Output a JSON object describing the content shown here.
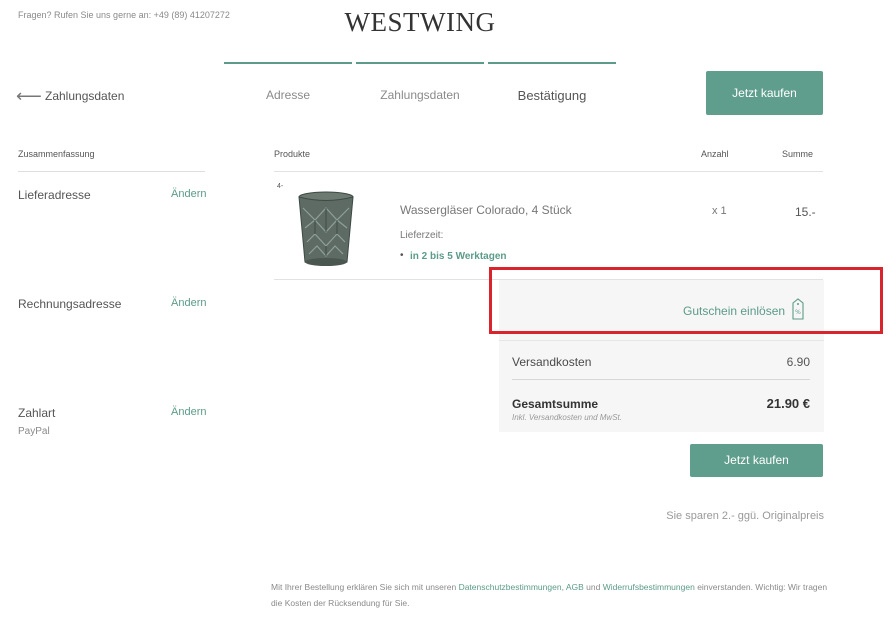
{
  "header": {
    "contact": "Fragen? Rufen Sie uns gerne an: +49 (89) 41207272",
    "logo": "WESTWING"
  },
  "steps": [
    {
      "label": "Adresse"
    },
    {
      "label": "Zahlungsdaten"
    },
    {
      "label": "Bestätigung"
    }
  ],
  "buy_button_top": "Jetzt kaufen",
  "back": {
    "label": "Zahlungsdaten"
  },
  "sidebar": {
    "title": "Zusammenfassung",
    "sections": [
      {
        "label": "Lieferadresse",
        "link": "Ändern"
      },
      {
        "label": "Rechnungsadresse",
        "link": "Ändern"
      },
      {
        "label": "Zahlart",
        "link": "Ändern",
        "value": "PayPal"
      }
    ]
  },
  "table": {
    "headers": {
      "products": "Produkte",
      "quantity": "Anzahl",
      "sum": "Summe"
    }
  },
  "product": {
    "badge": "4-",
    "name": "Wassergläser Colorado, 4 Stück",
    "delivery_label": "Lieferzeit:",
    "delivery_value": "in 2 bis 5 Werktagen",
    "quantity": "x 1",
    "price": "15.-"
  },
  "summary": {
    "coupon": "Gutschein einlösen",
    "shipping_label": "Versandkosten",
    "shipping_value": "6.90",
    "total_label": "Gesamtsumme",
    "total_sub": "Inkl. Versandkosten und MwSt.",
    "total_value": "21.90 €"
  },
  "buy_button_bottom": "Jetzt kaufen",
  "savings": "Sie sparen 2.- ggü. Originalpreis",
  "footer": {
    "part1": "Mit Ihrer Bestellung erklären Sie sich mit unseren ",
    "link1": "Datenschutzbestimmungen",
    "part2": ", ",
    "link2": "AGB",
    "part3": " und ",
    "link3": "Widerrufsbestimmungen",
    "part4": " einverstanden. Wichtig: Wir tragen die Kosten der Rücksendung für Sie."
  },
  "colors": {
    "accent": "#5f9d8c",
    "highlight": "#d9232d"
  }
}
